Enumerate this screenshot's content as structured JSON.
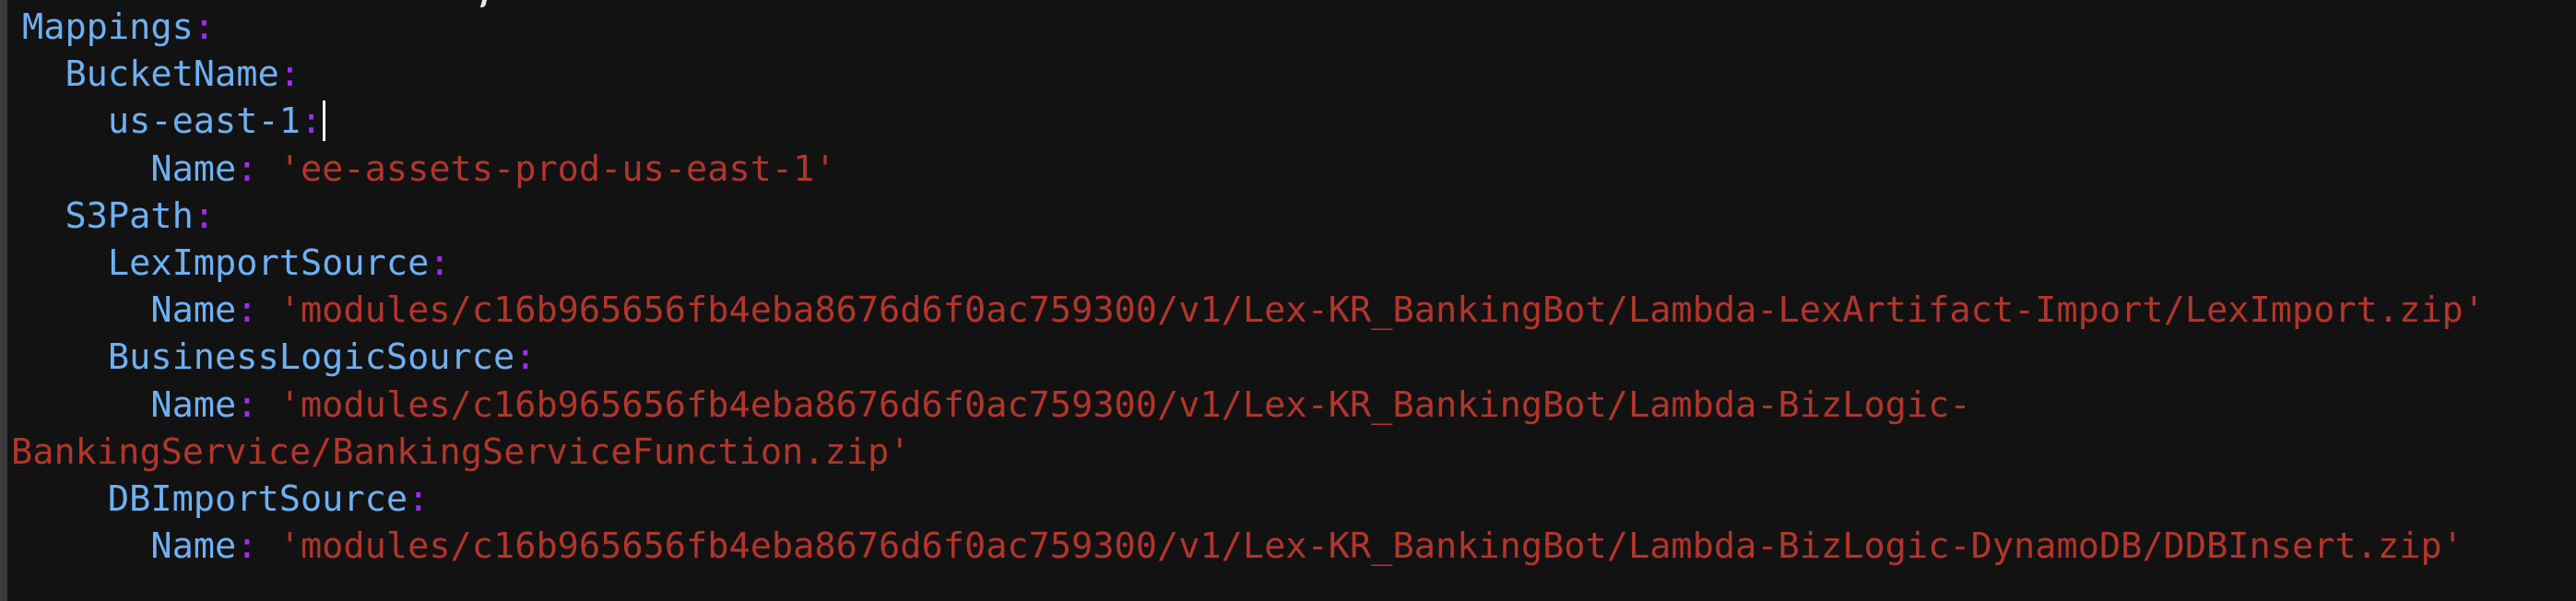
{
  "editor": {
    "lines": [
      {
        "indent": "",
        "key": "Mappings",
        "colon": ":"
      },
      {
        "indent": "  ",
        "key": "BucketName",
        "colon": ":"
      },
      {
        "indent": "    ",
        "key": "us-east-1",
        "colon": ":"
      },
      {
        "indent": "      ",
        "key": "Name",
        "colon": ":",
        "value": "'ee-assets-prod-us-east-1'"
      },
      {
        "indent": "  ",
        "key": "S3Path",
        "colon": ":"
      },
      {
        "indent": "    ",
        "key": "LexImportSource",
        "colon": ":"
      },
      {
        "indent": "      ",
        "key": "Name",
        "colon": ":",
        "value": "'modules/c16b965656fb4eba8676d6f0ac759300/v1/Lex-KR_BankingBot/Lambda-LexArtifact-Import/LexImport.zip'"
      },
      {
        "indent": "    ",
        "key": "BusinessLogicSource",
        "colon": ":"
      },
      {
        "indent": "      ",
        "key": "Name",
        "colon": ":",
        "value": "'modules/c16b965656fb4eba8676d6f0ac759300/v1/Lex-KR_BankingBot/Lambda-BizLogic-",
        "value_wrapped": "BankingService/BankingServiceFunction.zip'"
      },
      {
        "indent": "    ",
        "key": "DBImportSource",
        "colon": ":"
      },
      {
        "indent": "      ",
        "key": "Name",
        "colon": ":",
        "value": "'modules/c16b965656fb4eba8676d6f0ac759300/v1/Lex-KR_BankingBot/Lambda-BizLogic-DynamoDB/DDBInsert.zip'"
      }
    ]
  },
  "colors": {
    "background": "#121212",
    "key": "#6eb0f2",
    "colon": "#a12cf0",
    "string": "#b2352b"
  }
}
